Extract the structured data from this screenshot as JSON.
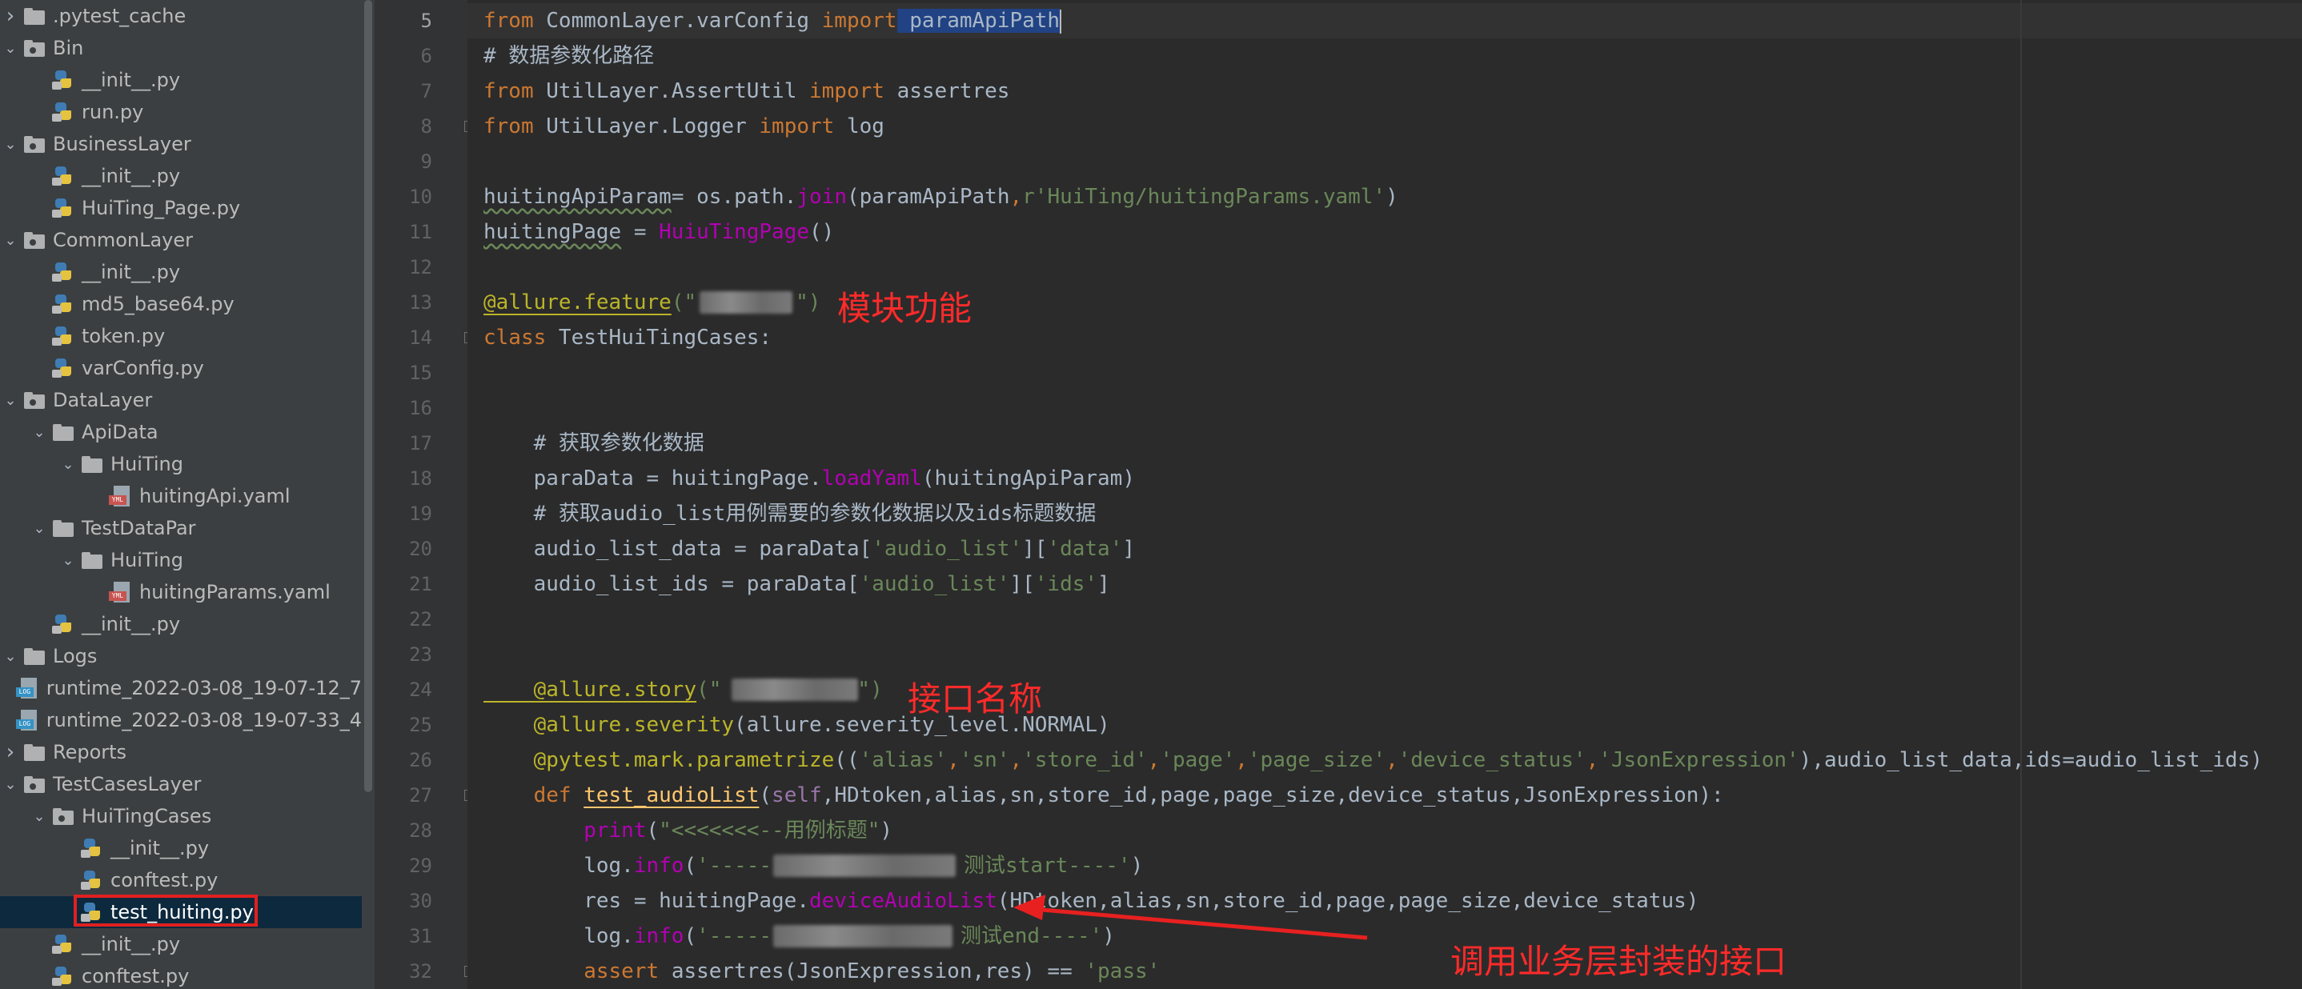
{
  "project_tree": [
    {
      "label": ".pytest_cache",
      "type": "folder",
      "level": 0,
      "expanded": false
    },
    {
      "label": "Bin",
      "type": "pkg",
      "level": 0,
      "expanded": true
    },
    {
      "label": "__init__.py",
      "type": "py",
      "level": 1
    },
    {
      "label": "run.py",
      "type": "py",
      "level": 1
    },
    {
      "label": "BusinessLayer",
      "type": "pkg",
      "level": 0,
      "expanded": true
    },
    {
      "label": "__init__.py",
      "type": "py",
      "level": 1
    },
    {
      "label": "HuiTing_Page.py",
      "type": "py",
      "level": 1
    },
    {
      "label": "CommonLayer",
      "type": "pkg",
      "level": 0,
      "expanded": true
    },
    {
      "label": "__init__.py",
      "type": "py",
      "level": 1
    },
    {
      "label": "md5_base64.py",
      "type": "py",
      "level": 1
    },
    {
      "label": "token.py",
      "type": "py",
      "level": 1
    },
    {
      "label": "varConfig.py",
      "type": "py",
      "level": 1
    },
    {
      "label": "DataLayer",
      "type": "pkg",
      "level": 0,
      "expanded": true
    },
    {
      "label": "ApiData",
      "type": "folder",
      "level": 1,
      "expanded": true
    },
    {
      "label": "HuiTing",
      "type": "folder",
      "level": 2,
      "expanded": true
    },
    {
      "label": "huitingApi.yaml",
      "type": "yml",
      "level": 3
    },
    {
      "label": "TestDataPar",
      "type": "folder",
      "level": 1,
      "expanded": true
    },
    {
      "label": "HuiTing",
      "type": "folder",
      "level": 2,
      "expanded": true
    },
    {
      "label": "huitingParams.yaml",
      "type": "yml",
      "level": 3
    },
    {
      "label": "__init__.py",
      "type": "py",
      "level": 1
    },
    {
      "label": "Logs",
      "type": "folder",
      "level": 0,
      "expanded": true
    },
    {
      "label": "runtime_2022-03-08_19-07-12_7",
      "type": "log",
      "level": 1
    },
    {
      "label": "runtime_2022-03-08_19-07-33_4",
      "type": "log",
      "level": 1
    },
    {
      "label": "Reports",
      "type": "folder",
      "level": 0,
      "expanded": false
    },
    {
      "label": "TestCasesLayer",
      "type": "pkg",
      "level": 0,
      "expanded": true
    },
    {
      "label": "HuiTingCases",
      "type": "pkg",
      "level": 1,
      "expanded": true
    },
    {
      "label": "__init__.py",
      "type": "py",
      "level": 2
    },
    {
      "label": "conftest.py",
      "type": "py",
      "level": 2
    },
    {
      "label": "test_huiting.py",
      "type": "py",
      "level": 2,
      "selected": true
    },
    {
      "label": "__init__.py",
      "type": "py",
      "level": 1
    },
    {
      "label": "conftest.py",
      "type": "py",
      "level": 1
    }
  ],
  "line_numbers": [
    "5",
    "6",
    "7",
    "8",
    "9",
    "10",
    "11",
    "12",
    "13",
    "14",
    "15",
    "16",
    "17",
    "18",
    "19",
    "20",
    "21",
    "22",
    "23",
    "24",
    "25",
    "26",
    "27",
    "28",
    "29",
    "30",
    "31",
    "32"
  ],
  "code": {
    "l5_a": "from",
    "l5_b": " CommonLayer.varConfig ",
    "l5_c": "import",
    "l5_d": " paramApiPath",
    "l6": "# 数据参数化路径",
    "l7_a": "from",
    "l7_b": " UtilLayer.AssertUtil ",
    "l7_c": "import",
    "l7_d": " assertres",
    "l8_a": "from",
    "l8_b": " UtilLayer.Logger ",
    "l8_c": "import",
    "l8_d": " log",
    "l10_a": "huitingApiParam",
    "l10_b": "= os.path.",
    "l10_c": "join",
    "l10_d": "(paramApiPath",
    "l10_e": ",",
    "l10_f": "r'HuiTing/huitingParams.yaml'",
    "l10_g": ")",
    "l11_a": "huitingPage",
    "l11_b": " = ",
    "l11_c": "HuiuTingPage",
    "l11_d": "()",
    "l13_a": "@allure.feature",
    "l13_b": "(\"",
    "l13_c": "\")",
    "l14_a": "class",
    "l14_b": " TestHuiTingCases:",
    "l17": "    # 获取参数化数据",
    "l18_a": "    paraData = huitingPage.",
    "l18_b": "loadYaml",
    "l18_c": "(huitingApiParam)",
    "l19": "    # 获取audio_list用例需要的参数化数据以及ids标题数据",
    "l20_a": "    audio_list_data = paraData[",
    "l20_b": "'audio_list'",
    "l20_c": "][",
    "l20_d": "'data'",
    "l20_e": "]",
    "l21_a": "    audio_list_ids = paraData[",
    "l21_b": "'audio_list'",
    "l21_c": "][",
    "l21_d": "'ids'",
    "l21_e": "]",
    "l24_a": "    @allure.story",
    "l24_b": "(\"",
    "l24_c": "\")",
    "l25_a": "    @allure.severity",
    "l25_b": "(allure.severity_level.NORMAL)",
    "l26_a": "    @pytest.mark.parametrize",
    "l26_b": "((",
    "l26_c": "'alias'",
    "l26_d": ",",
    "l26_e": "'sn'",
    "l26_f": "'store_id'",
    "l26_g": "'page'",
    "l26_h": "'page_size'",
    "l26_i": "'device_status'",
    "l26_j": "'JsonExpression'",
    "l26_k": "),audio_list_data,ids=audio_list_ids)",
    "l27_a": "    def ",
    "l27_b": "test_audioList",
    "l27_c": "(",
    "l27_d": "self",
    "l27_e": ",HDtoken,alias,sn,store_id,page,page_size,device_status,JsonExpression):",
    "l28_a": "        print",
    "l28_b": "(",
    "l28_c": "\"<<<<<<<--用例标题\"",
    "l28_d": ")",
    "l29_a": "        log.",
    "l29_b": "info",
    "l29_c": "(",
    "l29_d": "'-----",
    "l29_e": "测试start----'",
    "l29_f": ")",
    "l30_a": "        res = huitingPage.",
    "l30_b": "deviceAudioList",
    "l30_c": "(HDtoken,alias,sn,store_id,page,page_size,device_status)",
    "l31_a": "        log.",
    "l31_b": "info",
    "l31_c": "(",
    "l31_d": "'-----",
    "l31_e": "测试end----'",
    "l31_f": ")",
    "l32_a": "        assert ",
    "l32_b": "assertres(JsonExpression,res) == ",
    "l32_c": "'pass'"
  },
  "annotations": {
    "module": "模块功能",
    "api_name": "接口名称",
    "business": "调用业务层封装的接口"
  },
  "colors": {
    "annotation": "#ff2a2a",
    "keyword": "#cc7832",
    "string": "#6a8759",
    "decorator": "#bbb529",
    "comment": "#808080"
  }
}
